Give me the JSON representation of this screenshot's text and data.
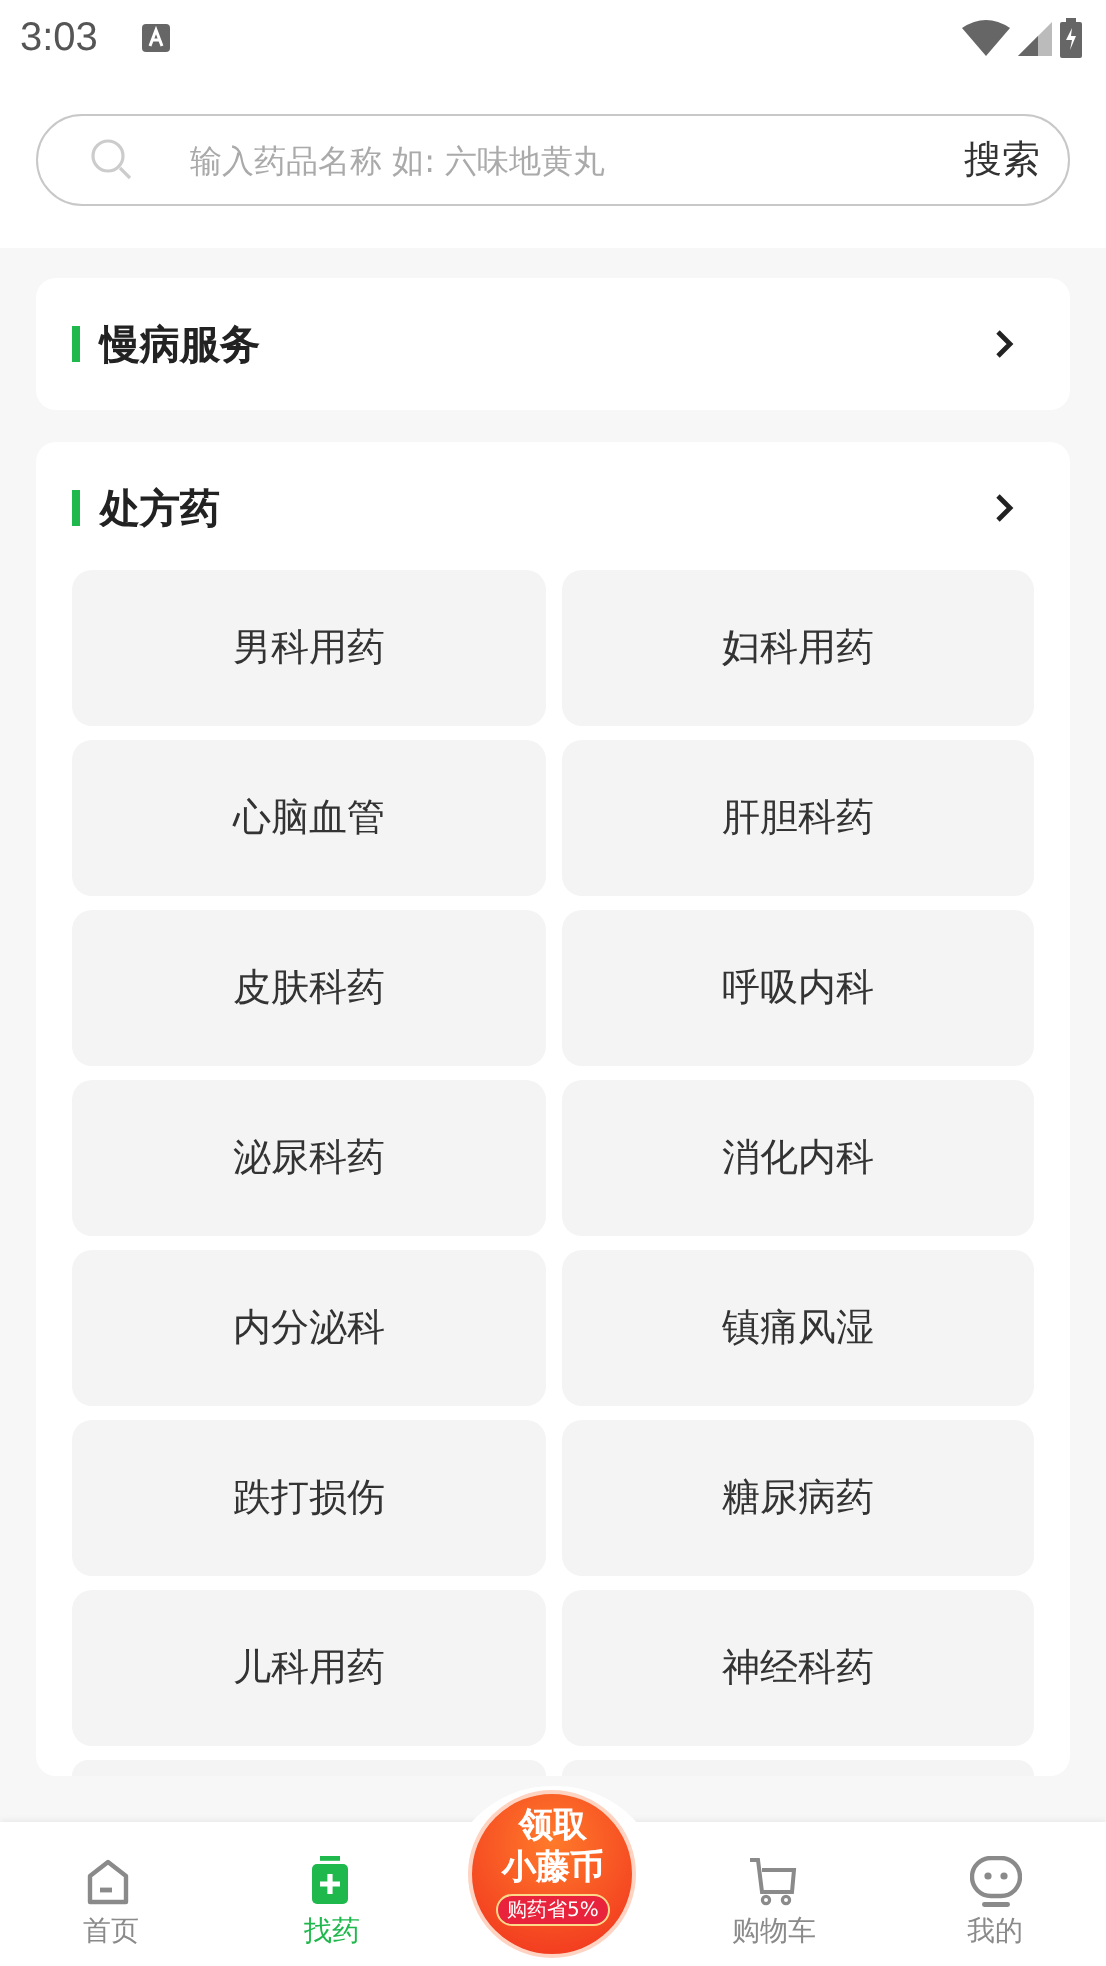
{
  "status_bar": {
    "time": "3:03"
  },
  "search": {
    "placeholder": "输入药品名称 如: 六味地黄丸",
    "button": "搜索"
  },
  "sections": [
    {
      "title": "慢病服务"
    },
    {
      "title": "处方药",
      "items": [
        "男科用药",
        "妇科用药",
        "心脑血管",
        "肝胆科药",
        "皮肤科药",
        "呼吸内科",
        "泌尿科药",
        "消化内科",
        "内分泌科",
        "镇痛风湿",
        "跌打损伤",
        "糖尿病药",
        "儿科用药",
        "神经科药"
      ]
    }
  ],
  "promo": {
    "line1": "领取",
    "line2": "小藤币",
    "tag": "购药省5%"
  },
  "tabs": [
    {
      "kind": "home",
      "label": "首页",
      "selected": false
    },
    {
      "kind": "medicine",
      "label": "找药",
      "selected": true
    },
    {
      "kind": "promo"
    },
    {
      "kind": "cart",
      "label": "购物车",
      "selected": false
    },
    {
      "kind": "me",
      "label": "我的",
      "selected": false
    }
  ]
}
